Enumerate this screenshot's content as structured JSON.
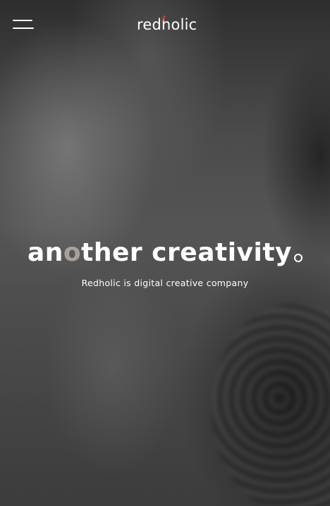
{
  "brand": {
    "logo_text": "redholic",
    "accent_color": "#e43a36"
  },
  "header": {
    "menu_icon": "hamburger-menu-icon"
  },
  "hero": {
    "headline_part1": "an",
    "headline_accent": "o",
    "headline_part2": "ther creativity",
    "headline_accent_color": "#a8a198",
    "subline": "Redholic is digital creative company"
  }
}
